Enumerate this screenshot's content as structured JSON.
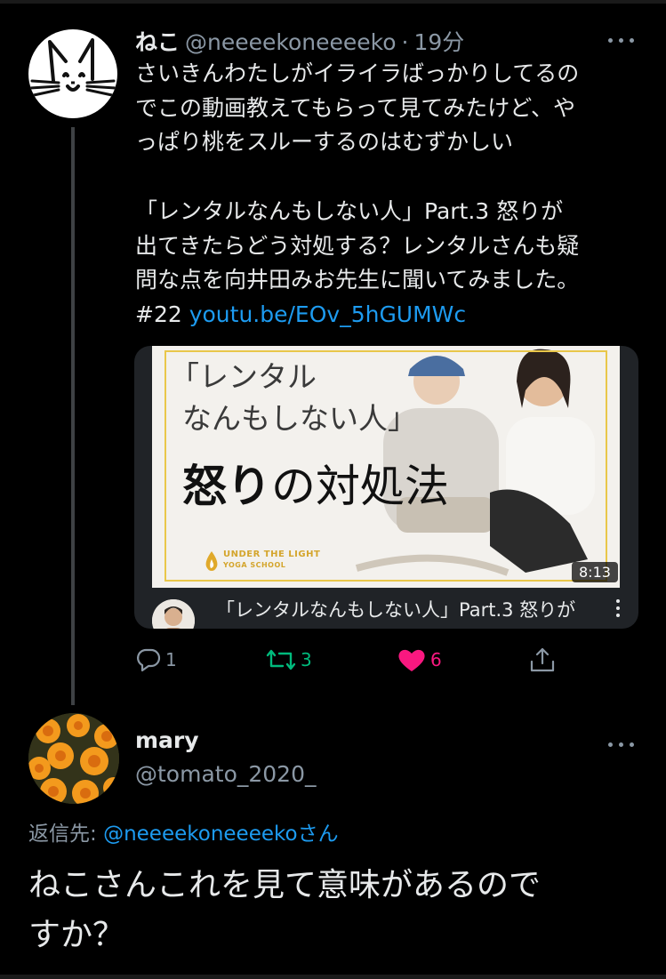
{
  "tweet": {
    "display_name": "ねこ",
    "handle": "@neeeekoneeeeko",
    "separator": "·",
    "time": "19分",
    "lines": [
      "さいきんわたしがイライラばっかりしてるの",
      "でこの動画教えてもらって見てみたけど、や",
      "っぱり桃をスルーするのはむずかしい"
    ],
    "lines2": [
      "「レンタルなんもしない人」Part.3 怒りが",
      "出てきたらどう対処する？レンタルさんも疑",
      "問な点を向井田みお先生に聞いてみました。"
    ],
    "hashtag_prefix": "#22",
    "link": "youtu.be/EOv_5hGUMWc"
  },
  "card": {
    "thumb_line1": "「レンタル",
    "thumb_line2": "なんもしない人」",
    "thumb_line3_bold": "怒り",
    "thumb_line3_rest": "の対処法",
    "logo_line1": "UNDER THE LIGHT",
    "logo_line2": "YOGA SCHOOL",
    "duration": "8:13",
    "title": "「レンタルなんもしない人」Part.3 怒りが"
  },
  "actions": {
    "reply_count": "1",
    "retweet_count": "3",
    "like_count": "6"
  },
  "reply": {
    "display_name": "mary",
    "handle": "@tomato_2020_",
    "reply_to_label": "返信先: ",
    "reply_to_handle": "@neeeekoneeeekoさん",
    "lines": [
      "ねこさんこれを見て意味があるので",
      "すか？"
    ]
  },
  "colors": {
    "background": "#000000",
    "link": "#1d9bf0",
    "secondary_text": "#8b98a5",
    "retweet": "#00ba7c",
    "like": "#f91880"
  },
  "icons": [
    "cat-avatar-icon",
    "more-icon",
    "reply-icon",
    "retweet-icon",
    "like-icon",
    "share-icon"
  ]
}
